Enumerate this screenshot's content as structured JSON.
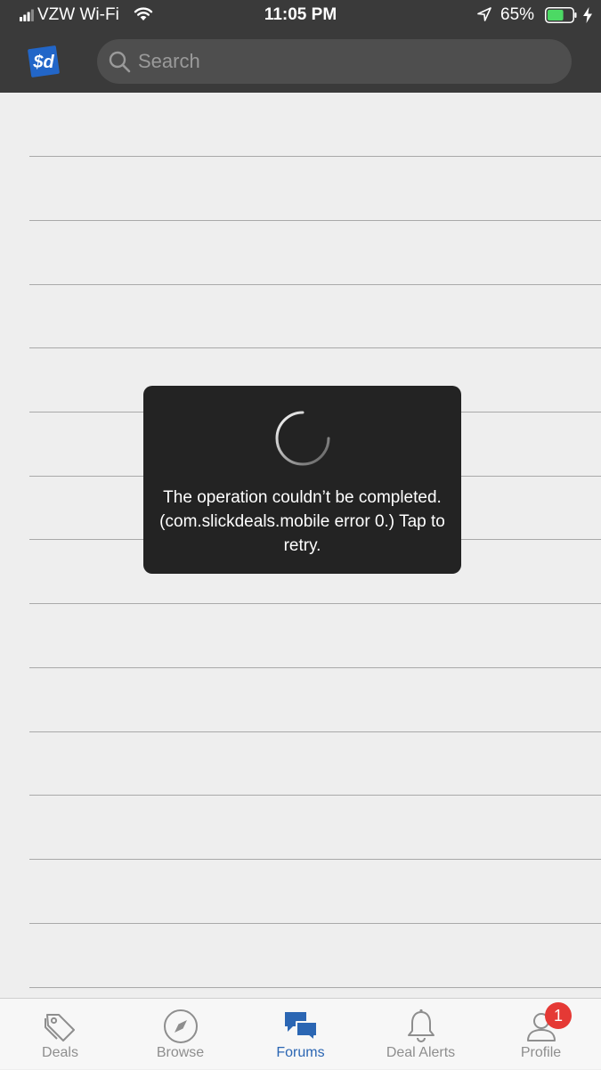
{
  "status_bar": {
    "carrier": "VZW Wi-Fi",
    "time": "11:05 PM",
    "battery_percent": "65%",
    "battery_level": 0.65,
    "icons": [
      "signal-icon",
      "wifi-icon",
      "location-arrow-icon",
      "battery-icon",
      "charging-bolt-icon"
    ]
  },
  "header": {
    "logo_text": "$d",
    "search": {
      "placeholder": "Search",
      "value": ""
    }
  },
  "toast": {
    "message": "The operation couldn’t be completed. (com.slickdeals.mobile error 0.) Tap to retry.",
    "icon": "loading-spinner-icon"
  },
  "tabbar": {
    "tabs": [
      {
        "label": "Deals",
        "icon": "tag-icon",
        "active": false
      },
      {
        "label": "Browse",
        "icon": "compass-icon",
        "active": false
      },
      {
        "label": "Forums",
        "icon": "chat-bubbles-icon",
        "active": true
      },
      {
        "label": "Deal Alerts",
        "icon": "bell-icon",
        "active": false
      },
      {
        "label": "Profile",
        "icon": "user-icon",
        "active": false
      }
    ],
    "profile_badge": "1"
  },
  "colors": {
    "header_bg": "#3a3a3a",
    "content_bg": "#eeeeee",
    "active_tab": "#2b66b3",
    "inactive_tab": "#8e8e8e",
    "badge": "#e53935",
    "battery": "#4cd964"
  }
}
